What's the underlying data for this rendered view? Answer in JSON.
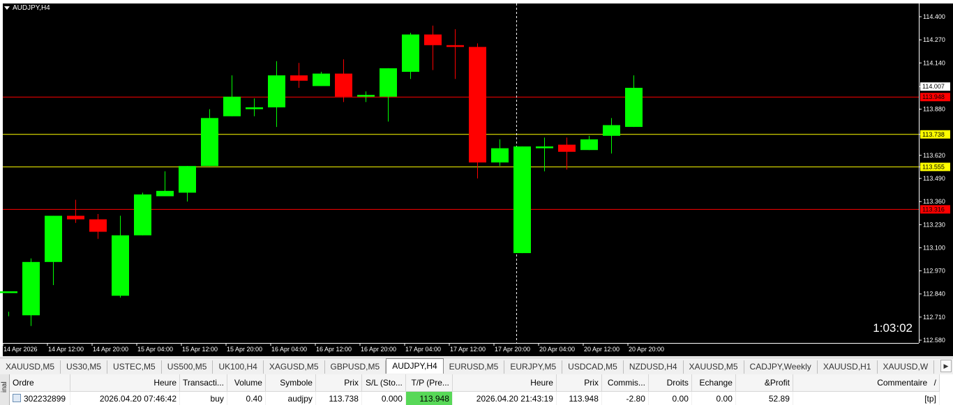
{
  "chart": {
    "symbol_label": "AUDJPY,H4",
    "countdown": "1:03:02",
    "colors": {
      "background": "#000000",
      "bull": "#00ff00",
      "bear": "#ff0000",
      "axis": "#ffffff",
      "crosshair": "#ffffff"
    },
    "price_ticks": [
      "114.400",
      "114.270",
      "114.140",
      "114.007",
      "113.880",
      "113.738",
      "113.620",
      "113.555",
      "113.490",
      "113.360",
      "113.230",
      "113.100",
      "112.970",
      "112.840",
      "112.710",
      "112.580"
    ],
    "price_tags": [
      {
        "label": "114.007",
        "value": 114.007,
        "bg": "#ffffff",
        "fg": "#000000"
      },
      {
        "label": "113.948",
        "value": 113.948,
        "bg": "#ff0000",
        "fg": "#000000"
      },
      {
        "label": "113.738",
        "value": 113.738,
        "bg": "#ffff00",
        "fg": "#000000"
      },
      {
        "label": "113.555",
        "value": 113.555,
        "bg": "#ffff00",
        "fg": "#000000"
      },
      {
        "label": "113.316",
        "value": 113.316,
        "bg": "#ff0000",
        "fg": "#000000"
      }
    ],
    "time_labels": [
      "14 Apr 2026",
      "14 Apr 12:00",
      "14 Apr 20:00",
      "15 Apr 04:00",
      "15 Apr 12:00",
      "15 Apr 20:00",
      "16 Apr 04:00",
      "16 Apr 12:00",
      "16 Apr 20:00",
      "17 Apr 04:00",
      "17 Apr 12:00",
      "17 Apr 20:00",
      "20 Apr 04:00",
      "20 Apr 12:00",
      "20 Apr 20:00"
    ]
  },
  "chart_data": {
    "type": "candlestick",
    "symbol": "AUDJPY",
    "timeframe": "H4",
    "ylim": [
      112.58,
      114.4
    ],
    "hlines": [
      {
        "value": 113.948,
        "color": "#ff0000"
      },
      {
        "value": 113.738,
        "color": "#ffff00"
      },
      {
        "value": 113.555,
        "color": "#ffff00"
      },
      {
        "value": 113.316,
        "color": "#ff0000"
      }
    ],
    "candles": [
      [
        112.845,
        112.855,
        112.74,
        112.715
      ],
      [
        112.72,
        113.02,
        113.04,
        112.66
      ],
      [
        113.02,
        113.28,
        113.28,
        112.89
      ],
      [
        113.28,
        113.26,
        113.37,
        113.24
      ],
      [
        113.26,
        113.19,
        113.29,
        113.15
      ],
      [
        112.83,
        113.17,
        113.28,
        112.82
      ],
      [
        113.17,
        113.4,
        113.41,
        113.17
      ],
      [
        113.39,
        113.42,
        113.53,
        113.39
      ],
      [
        113.41,
        113.56,
        113.56,
        113.36
      ],
      [
        113.56,
        113.83,
        113.88,
        113.56
      ],
      [
        113.84,
        113.95,
        114.07,
        113.84
      ],
      [
        113.88,
        113.89,
        113.94,
        113.84
      ],
      [
        113.89,
        114.07,
        114.15,
        113.78
      ],
      [
        114.07,
        114.04,
        114.14,
        114.0
      ],
      [
        114.01,
        114.08,
        114.09,
        114.01
      ],
      [
        114.08,
        113.95,
        114.16,
        113.92
      ],
      [
        113.95,
        113.96,
        113.98,
        113.92
      ],
      [
        113.95,
        114.11,
        114.11,
        113.81
      ],
      [
        114.09,
        114.3,
        114.31,
        114.05
      ],
      [
        114.3,
        114.24,
        114.35,
        114.1
      ],
      [
        114.24,
        114.23,
        114.33,
        114.05
      ],
      [
        114.23,
        113.58,
        114.25,
        113.49
      ],
      [
        113.58,
        113.66,
        113.71,
        113.56
      ],
      [
        113.07,
        113.67,
        113.67,
        113.07
      ],
      [
        113.66,
        113.67,
        113.72,
        113.53
      ],
      [
        113.68,
        113.64,
        113.72,
        113.54
      ],
      [
        113.65,
        113.71,
        113.73,
        113.65
      ],
      [
        113.73,
        113.79,
        113.83,
        113.63
      ],
      [
        113.78,
        114.0,
        114.07,
        113.78
      ]
    ]
  },
  "tabs": {
    "items": [
      "XAUUSD,M5",
      "US30,M5",
      "USTEC,M5",
      "US500,M5",
      "UK100,H4",
      "XAGUSD,M5",
      "GBPUSD,M5",
      "AUDJPY,H4",
      "EURUSD,M5",
      "EURJPY,M5",
      "USDCAD,M5",
      "NZDUSD,H4",
      "XAUUSD,M5",
      "CADJPY,Weekly",
      "XAUUSD,H1",
      "XAUUSD,W"
    ],
    "active_index": 7
  },
  "terminal": {
    "side_label": "inal",
    "columns": [
      "Ordre",
      "Heure",
      "Transacti...",
      "Volume",
      "Symbole",
      "Prix",
      "S/L (Sto...",
      "T/P (Pre...",
      "Heure",
      "Prix",
      "Commis...",
      "Droits",
      "Echange",
      "&Profit",
      "Commentaire"
    ],
    "rows": [
      [
        "302232899",
        "2026.04.20 07:46:42",
        "buy",
        "0.40",
        "audjpy",
        "113.738",
        "0.000",
        "113.948",
        "2026.04.20 21:43:19",
        "113.948",
        "-2.80",
        "0.00",
        "0.00",
        "52.89",
        "[tp]"
      ]
    ],
    "sort_indicator": "/"
  }
}
